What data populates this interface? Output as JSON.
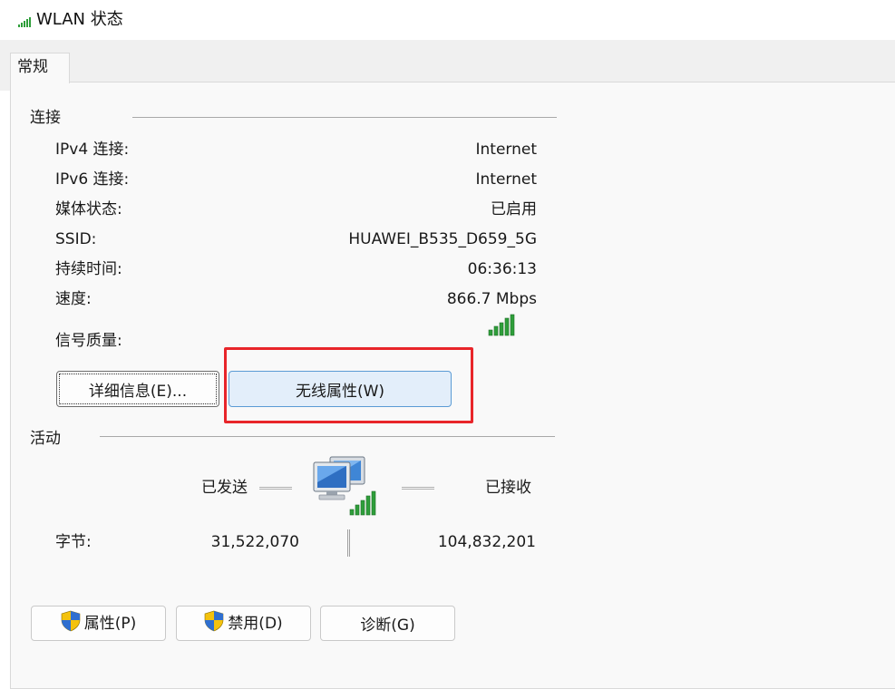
{
  "window": {
    "title": "WLAN 状态"
  },
  "tabs": [
    {
      "label": "常规"
    }
  ],
  "connection": {
    "section_label": "连接",
    "rows": [
      {
        "label": "IPv4 连接:",
        "value": "Internet"
      },
      {
        "label": "IPv6 连接:",
        "value": "Internet"
      },
      {
        "label": "媒体状态:",
        "value": "已启用"
      },
      {
        "label": "SSID:",
        "value": "HUAWEI_B535_D659_5G"
      },
      {
        "label": "持续时间:",
        "value": "06:36:13"
      },
      {
        "label": "速度:",
        "value": "866.7 Mbps"
      }
    ],
    "signal_label": "信号质量:",
    "signal_bars": 5,
    "details_button": "详细信息(E)...",
    "wireless_props_button": "无线属性(W)"
  },
  "activity": {
    "section_label": "活动",
    "sent_label": "已发送",
    "received_label": "已接收",
    "bytes_label": "字节:",
    "bytes_sent": "31,522,070",
    "bytes_received": "104,832,201"
  },
  "buttons": {
    "properties": "属性(P)",
    "disable": "禁用(D)",
    "diagnose": "诊断(G)"
  },
  "icons": {
    "title": "wifi-signal-icon",
    "signal": "signal-bars-icon",
    "network": "network-computers-icon",
    "shield": "uac-shield-icon"
  },
  "colors": {
    "signal_green": "#2e9e3a",
    "highlight_red": "#e8252a",
    "selected_button_bg": "#e3eefa",
    "selected_button_border": "#5b9bd5"
  }
}
